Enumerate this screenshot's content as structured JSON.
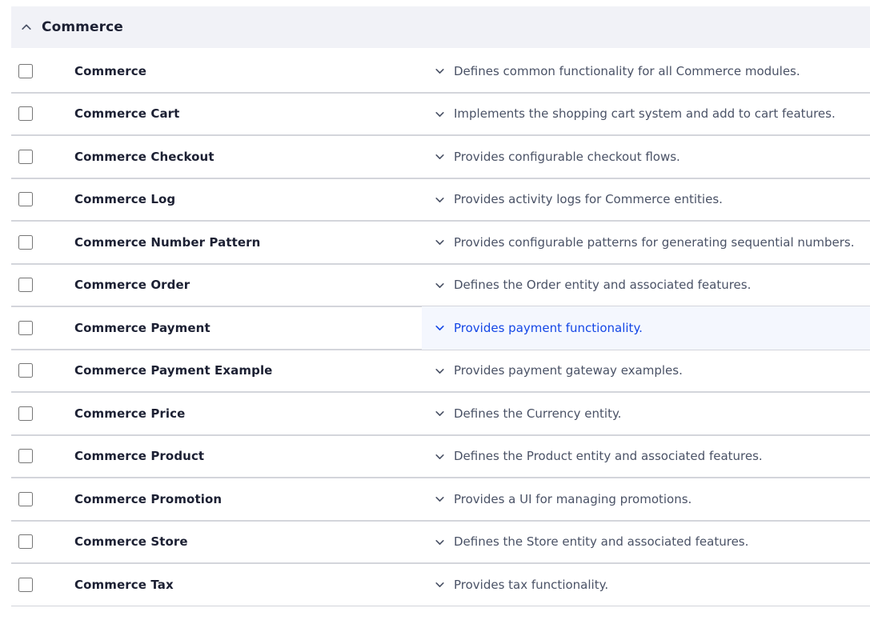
{
  "group": {
    "title": "Commerce",
    "expanded": true,
    "toggle_icon": "chevron-up-icon"
  },
  "colors": {
    "header_bg": "#f1f2f7",
    "row_divider": "#d3d5db",
    "active_row_bg": "#f4f7fe",
    "active_text": "#1447e6",
    "name_text": "#1c2033",
    "desc_text": "#4a5266",
    "checkbox_border": "#8b8f9c"
  },
  "row_icon": "chevron-down-icon",
  "checkbox_icon": "unchecked-checkbox-icon",
  "modules": [
    {
      "name": "Commerce",
      "description": "Defines common functionality for all Commerce modules.",
      "checked": false,
      "active": false
    },
    {
      "name": "Commerce Cart",
      "description": "Implements the shopping cart system and add to cart features.",
      "checked": false,
      "active": false
    },
    {
      "name": "Commerce Checkout",
      "description": "Provides configurable checkout flows.",
      "checked": false,
      "active": false
    },
    {
      "name": "Commerce Log",
      "description": "Provides activity logs for Commerce entities.",
      "checked": false,
      "active": false
    },
    {
      "name": "Commerce Number Pattern",
      "description": "Provides configurable patterns for generating sequential numbers.",
      "checked": false,
      "active": false
    },
    {
      "name": "Commerce Order",
      "description": "Defines the Order entity and associated features.",
      "checked": false,
      "active": false
    },
    {
      "name": "Commerce Payment",
      "description": "Provides payment functionality.",
      "checked": false,
      "active": true
    },
    {
      "name": "Commerce Payment Example",
      "description": "Provides payment gateway examples.",
      "checked": false,
      "active": false
    },
    {
      "name": "Commerce Price",
      "description": "Defines the Currency entity.",
      "checked": false,
      "active": false
    },
    {
      "name": "Commerce Product",
      "description": "Defines the Product entity and associated features.",
      "checked": false,
      "active": false
    },
    {
      "name": "Commerce Promotion",
      "description": "Provides a UI for managing promotions.",
      "checked": false,
      "active": false
    },
    {
      "name": "Commerce Store",
      "description": "Defines the Store entity and associated features.",
      "checked": false,
      "active": false
    },
    {
      "name": "Commerce Tax",
      "description": "Provides tax functionality.",
      "checked": false,
      "active": false
    }
  ]
}
